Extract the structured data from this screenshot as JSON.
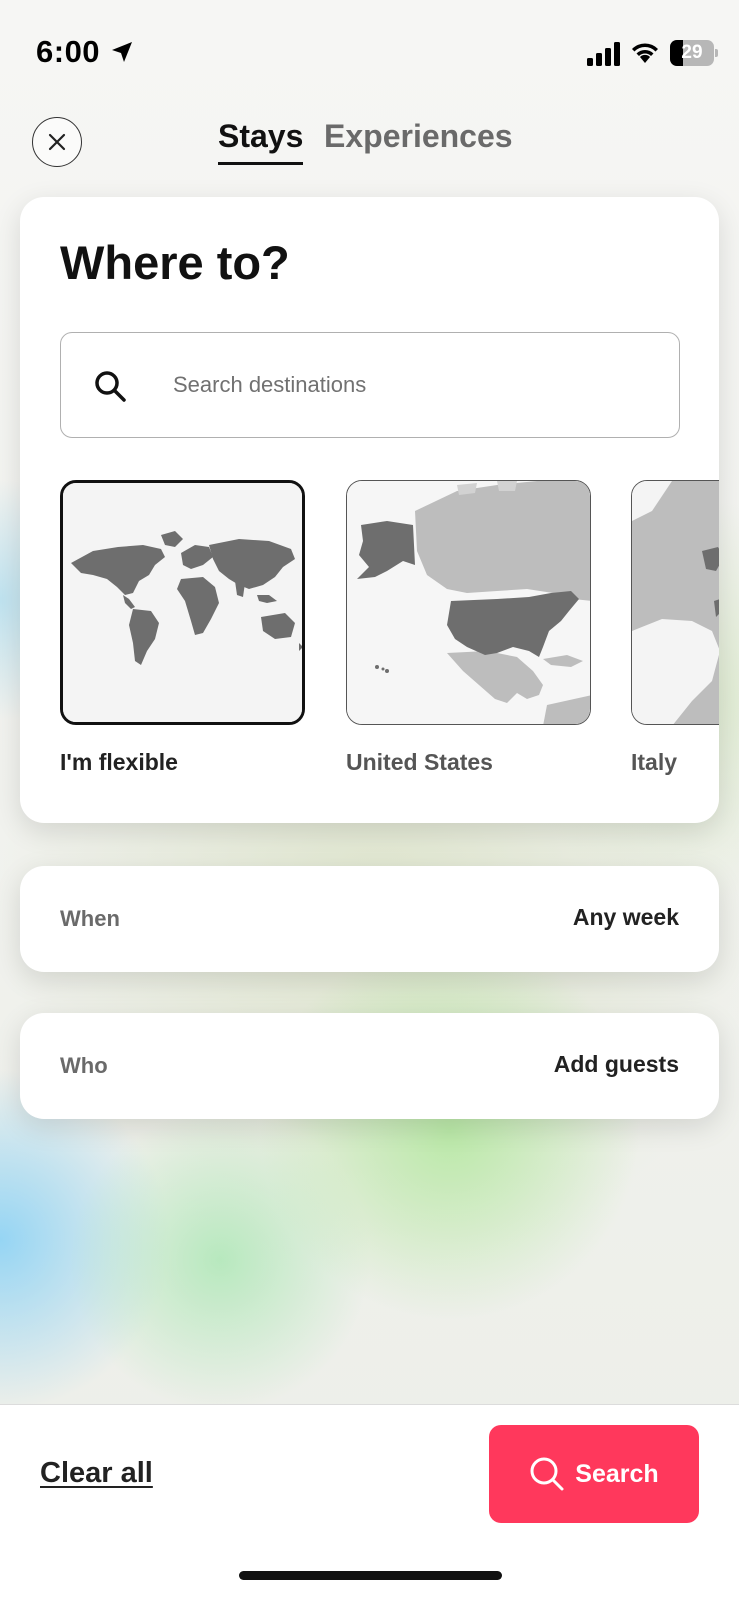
{
  "status_bar": {
    "time": "6:00",
    "battery": "29",
    "icons": [
      "location-arrow-icon",
      "signal-icon",
      "wifi-icon",
      "battery-icon"
    ]
  },
  "header": {
    "close_icon": "close-icon",
    "tabs": [
      {
        "label": "Stays",
        "selected": true
      },
      {
        "label": "Experiences",
        "selected": false
      }
    ]
  },
  "where": {
    "title": "Where to?",
    "search": {
      "placeholder": "Search destinations",
      "value": "",
      "icon": "search-icon"
    },
    "destinations": [
      {
        "label": "I'm flexible",
        "selected": true
      },
      {
        "label": "United States",
        "selected": false
      },
      {
        "label": "Italy",
        "selected": false
      }
    ]
  },
  "when": {
    "label": "When",
    "value": "Any week"
  },
  "who": {
    "label": "Who",
    "value": "Add guests"
  },
  "footer": {
    "clear_label": "Clear all",
    "search_label": "Search",
    "search_icon": "search-icon"
  },
  "colors": {
    "accent": "#ff385c",
    "text": "#222222",
    "muted": "#6a6a6a",
    "map_land": "#6e6e6e",
    "map_land_light": "#bdbdbd"
  }
}
